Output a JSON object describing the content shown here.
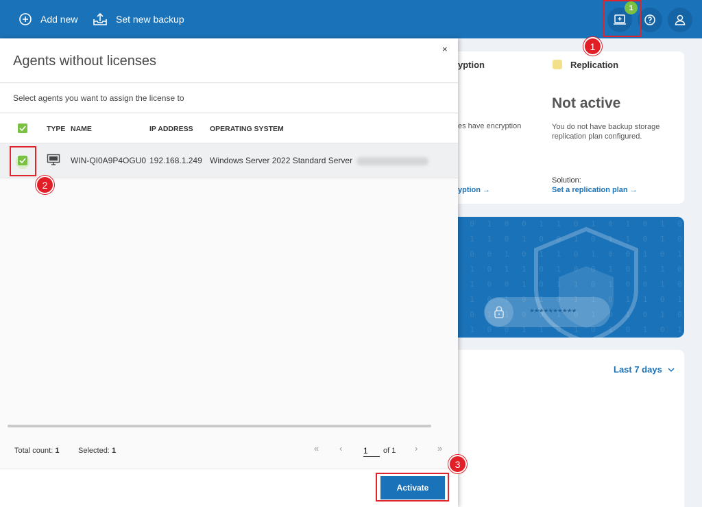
{
  "topbar": {
    "add_new": "Add new",
    "set_new_backup": "Set new backup",
    "notification_count": "1"
  },
  "dashboard": {
    "encryption_title": "yption",
    "encryption_text": "es have encryption",
    "encryption_link": "yption →",
    "replication_title": "Replication",
    "replication_status": "Not active",
    "replication_desc": "You do not have backup storage replication plan configured.",
    "solution_label": "Solution:",
    "replication_link": "Set a replication plan →",
    "password_mask": "**********",
    "period_select": "Last 7 days"
  },
  "modal": {
    "title": "Agents without licenses",
    "close": "×",
    "subtitle": "Select agents you want to assign the license to",
    "columns": [
      "TYPE",
      "NAME",
      "IP ADDRESS",
      "OPERATING SYSTEM"
    ],
    "rows": [
      {
        "name": "WIN-QI0A9P4OGU0",
        "ip": "192.168.1.249",
        "os": "Windows Server 2022 Standard Server"
      }
    ],
    "total_count_label": "Total count:",
    "total_count": "1",
    "selected_label": "Selected:",
    "selected": "1",
    "page": "1",
    "page_of": "of 1",
    "activate": "Activate"
  },
  "annotations": [
    "1",
    "2",
    "3"
  ],
  "colors": {
    "brand_blue": "#1a72b8",
    "accent_green": "#7ac143",
    "marker_red": "#e21f26"
  }
}
